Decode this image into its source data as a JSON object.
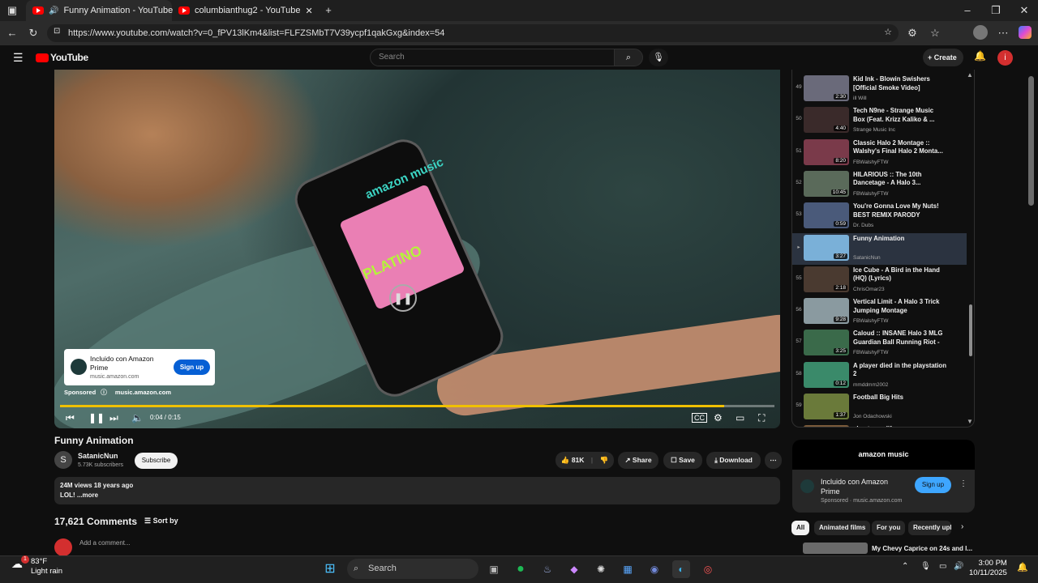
{
  "browser": {
    "tabs": [
      {
        "title": "Funny Animation - YouTube",
        "active": true
      },
      {
        "title": "columbianthug2 - YouTube",
        "active": false
      }
    ],
    "url": "https://www.youtube.com/watch?v=0_fPV13lKm4&list=FLFZSMbT7V39ycpf1qakGxg&index=54"
  },
  "youtube": {
    "logo": "YouTube",
    "search_placeholder": "Search",
    "create_label": "Create",
    "avatar_letter": "i"
  },
  "player": {
    "progress_fraction": 0.93,
    "time": "0:04 / 0:15",
    "phone_brand": "amazon music",
    "album_text": "PLATINO",
    "ad": {
      "title": "Incluido con Amazon Prime",
      "url": "music.amazon.com",
      "button": "Sign up",
      "sponsored": "Sponsored",
      "sponsor_url": "music.amazon.com"
    }
  },
  "video": {
    "title": "Funny Animation",
    "channel": "SatanicNun",
    "channel_initial": "S",
    "subscribers": "5.73K subscribers",
    "subscribe_label": "Subscribe",
    "likes": "81K",
    "share_label": "Share",
    "save_label": "Save",
    "download_label": "Download",
    "views": "24M views  18 years ago",
    "description": "LOL! ...more",
    "comments_count": "17,621 Comments",
    "sort_label": "Sort by",
    "add_comment": "Add a comment..."
  },
  "playlist": [
    {
      "index": "49",
      "title": "Kid Ink - Blowin Swishers [Official Smoke Video]",
      "channel": "ill Will",
      "duration": "2:30",
      "color": "#6a6a7a"
    },
    {
      "index": "50",
      "title": "Tech N9ne - Strange Music Box (Feat. Krizz Kaliko & ...",
      "channel": "Strange Music Inc",
      "duration": "4:40",
      "color": "#3a2a2a"
    },
    {
      "index": "51",
      "title": "Classic Halo 2 Montage :: Walshy's Final Halo 2 Monta...",
      "channel": "FBWalshyFTW",
      "duration": "8:20",
      "color": "#7a3a4a"
    },
    {
      "index": "52",
      "title": "HILARIOUS :: The 10th Dancetage - A Halo 3...",
      "channel": "FBWalshyFTW",
      "duration": "10:45",
      "color": "#5a6a5a"
    },
    {
      "index": "53",
      "title": "You're Gonna Love My Nuts! BEST REMIX PARODY",
      "channel": "Dr. Dubs",
      "duration": "0:59",
      "color": "#4a5a7a"
    },
    {
      "index": "",
      "title": "Funny Animation",
      "channel": "SatanicNun",
      "duration": "3:27",
      "color": "#7ab0d8",
      "active": true
    },
    {
      "index": "55",
      "title": "Ice Cube - A Bird in the Hand (HQ) (Lyrics)",
      "channel": "ChrisOmar23",
      "duration": "2:18",
      "color": "#4a3a30"
    },
    {
      "index": "56",
      "title": "Vertical Limit - A Halo 3 Trick Jumping Montage",
      "channel": "FBWalshyFTW",
      "duration": "9:28",
      "color": "#8a9aa0"
    },
    {
      "index": "57",
      "title": "Caloud :: INSANE Halo 3 MLG Guardian Ball Running Riot - ...",
      "channel": "FBWalshyFTW",
      "duration": "3:25",
      "color": "#3a6a4a"
    },
    {
      "index": "58",
      "title": "A player died in the playstation 2",
      "channel": "mmddmm2002",
      "duration": "0:12",
      "color": "#3a8a6a"
    },
    {
      "index": "59",
      "title": "Football Big Hits",
      "channel": "Jon Odachowski",
      "duration": "1:37",
      "color": "#6a7a3a"
    },
    {
      "index": "",
      "title": "el gato my life",
      "channel": "",
      "duration": "",
      "color": "#7a5a3a"
    }
  ],
  "side_ad": {
    "banner": "amazon music",
    "title": "Incluido con Amazon Prime",
    "sponsored": "Sponsored · music.amazon.com",
    "button": "Sign up"
  },
  "chips": [
    "All",
    "Animated films",
    "For you",
    "Recently uplo"
  ],
  "next_video": "My Chevy Caprice on 24s and l...",
  "taskbar": {
    "temp": "83°F",
    "weather": "Light rain",
    "search": "Search",
    "time": "3:00 PM",
    "date": "10/11/2025",
    "badge": "1"
  }
}
